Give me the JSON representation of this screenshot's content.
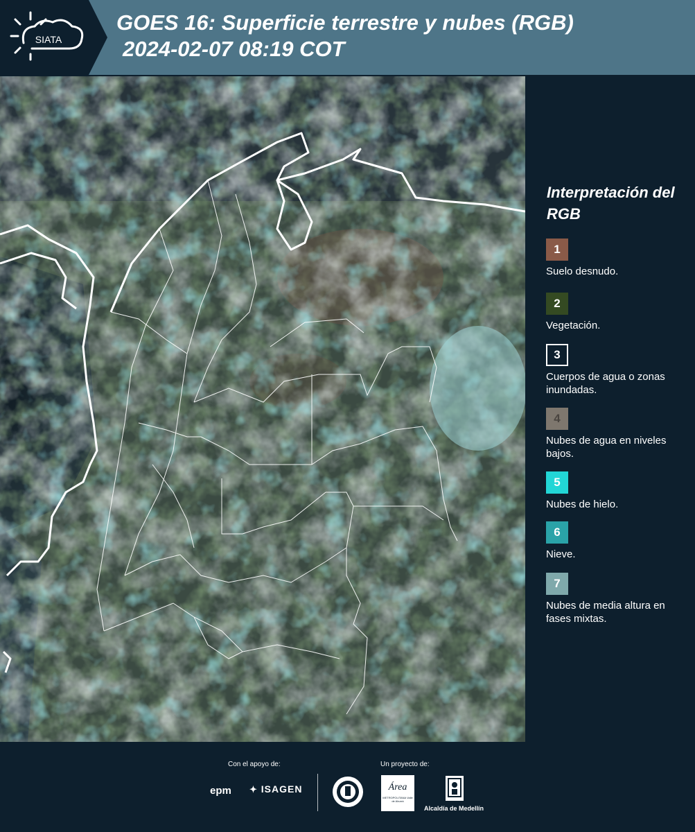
{
  "header": {
    "logo_text": "SIATA",
    "title_line1": "GOES 16: Superficie terrestre y nubes (RGB)",
    "title_line2": "2024-02-07 08:19 COT"
  },
  "map": {
    "description_icon": "satellite-rgb-map"
  },
  "legend": {
    "title": "Interpretación del RGB",
    "items": [
      {
        "number": "1",
        "label": "Suelo desnudo.",
        "color": "#8a5a48"
      },
      {
        "number": "2",
        "label": "Vegetación.",
        "color": "#344a22"
      },
      {
        "number": "3",
        "label": "Cuerpos de agua o zonas inundadas.",
        "color": "#0d1f2d"
      },
      {
        "number": "4",
        "label": "Nubes de agua en niveles bajos.",
        "color": "#7e776e"
      },
      {
        "number": "5",
        "label": "Nubes de hielo.",
        "color": "#22d6d6"
      },
      {
        "number": "6",
        "label": "Nieve.",
        "color": "#2aa3a8"
      },
      {
        "number": "7",
        "label": "Nubes de media altura en fases mixtas.",
        "color": "#7fa9ab"
      }
    ]
  },
  "footer": {
    "support_label": "Con el apoyo de:",
    "project_label": "Un proyecto de:",
    "sponsor1": "epm",
    "sponsor2": "ISAGEN",
    "partner_area": "Área",
    "partner_area_sub": "METROPOLITANA Valle de Aburrá",
    "partner_alcaldia": "Alcaldía de Medellín"
  }
}
